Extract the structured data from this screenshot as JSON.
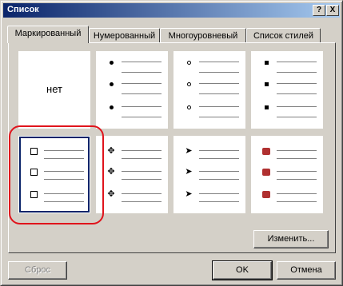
{
  "window": {
    "title": "Список"
  },
  "titlebar": {
    "help_label": "?",
    "close_label": "X"
  },
  "tabs": [
    {
      "label": "Маркированный"
    },
    {
      "label": "Нумерованный"
    },
    {
      "label": "Многоуровневый"
    },
    {
      "label": "Список стилей"
    }
  ],
  "gallery": {
    "none_label": "нет",
    "styles": [
      {
        "bullet": "none"
      },
      {
        "bullet": "filled-dot-icon"
      },
      {
        "bullet": "hollow-circle-icon"
      },
      {
        "bullet": "filled-square-icon"
      },
      {
        "bullet": "hollow-box-icon",
        "selected": true
      },
      {
        "bullet": "four-diamond-icon",
        "glyph": "✥"
      },
      {
        "bullet": "arrowhead-icon",
        "glyph": "➤"
      },
      {
        "bullet": "red-picture-bullet-icon"
      }
    ]
  },
  "buttons": {
    "modify_label": "Изменить...",
    "reset_label": "Сброс",
    "ok_label": "OK",
    "cancel_label": "Отмена"
  },
  "colors": {
    "titlebar_start": "#0a246a",
    "titlebar_end": "#a6caf0",
    "highlight": "#e0141c"
  }
}
